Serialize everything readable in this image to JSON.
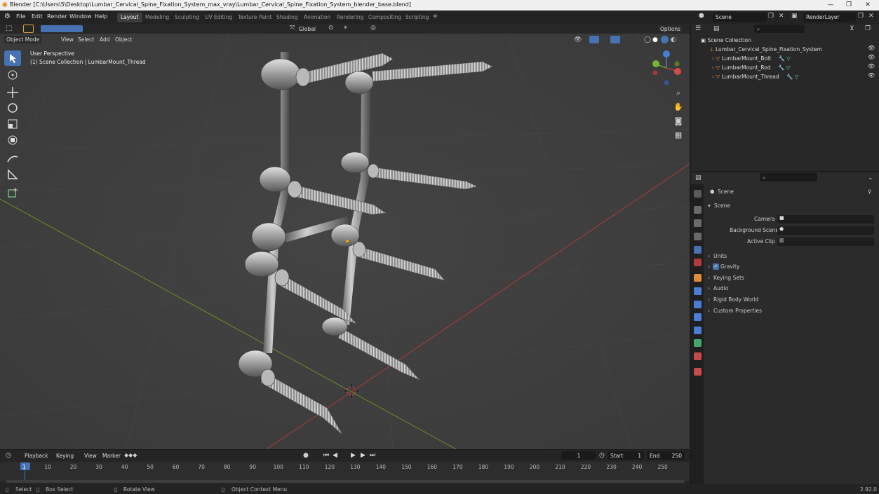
{
  "window": {
    "title": "Blender [C:\\Users\\5\\Desktop\\Lumbar_Cervical_Spine_Fixation_System_max_vray\\Lumbar_Cervical_Spine_Fixation_System_blender_base.blend]",
    "min": "—",
    "max": "❐",
    "close": "✕"
  },
  "menu": [
    "File",
    "Edit",
    "Render",
    "Window",
    "Help"
  ],
  "workspaces": [
    "Layout",
    "Modeling",
    "Sculpting",
    "UV Editing",
    "Texture Paint",
    "Shading",
    "Animation",
    "Rendering",
    "Compositing",
    "Scripting"
  ],
  "scene_field": "Scene",
  "render_layer": "RenderLayer",
  "viewport": {
    "mode": "Object Mode",
    "menus": [
      "View",
      "Select",
      "Add",
      "Object"
    ],
    "orientation": "Global",
    "options": "Options",
    "info_line1": "User Perspective",
    "info_line2": "(1) Scene Collection | LumbarMount_Thread"
  },
  "outliner": {
    "root": "Scene Collection",
    "collection": "Lumbar_Cervical_Spine_Fixation_System",
    "objects": [
      "LumbarMount_Bolt",
      "LumbarMount_Rod",
      "LumbarMount_Thread"
    ]
  },
  "properties": {
    "context": "Scene",
    "panel": "Scene",
    "camera_label": "Camera",
    "bg_scene_label": "Background Scene",
    "active_clip_label": "Active Clip",
    "sections": [
      "Units",
      "Gravity",
      "Keying Sets",
      "Audio",
      "Rigid Body World",
      "Custom Properties"
    ]
  },
  "timeline": {
    "menus": [
      "Playback",
      "Keying",
      "View",
      "Marker"
    ],
    "current_frame": "1",
    "start_label": "Start",
    "start": "1",
    "end_label": "End",
    "end": "250",
    "ticks": [
      "1",
      "10",
      "20",
      "30",
      "40",
      "50",
      "60",
      "70",
      "80",
      "90",
      "100",
      "110",
      "120",
      "130",
      "140",
      "150",
      "160",
      "170",
      "180",
      "190",
      "200",
      "210",
      "220",
      "230",
      "240",
      "250"
    ]
  },
  "status": {
    "select": "Select",
    "box_select": "Box Select",
    "rotate": "Rotate View",
    "context_menu": "Object Context Menu",
    "version": "2.92.0"
  },
  "colors": {
    "accent": "#4772b3",
    "x_axis": "#c0392b",
    "y_axis": "#6a8f1f",
    "mesh_icon": "#e08a3c",
    "vis_green": "#5cd0a0"
  }
}
